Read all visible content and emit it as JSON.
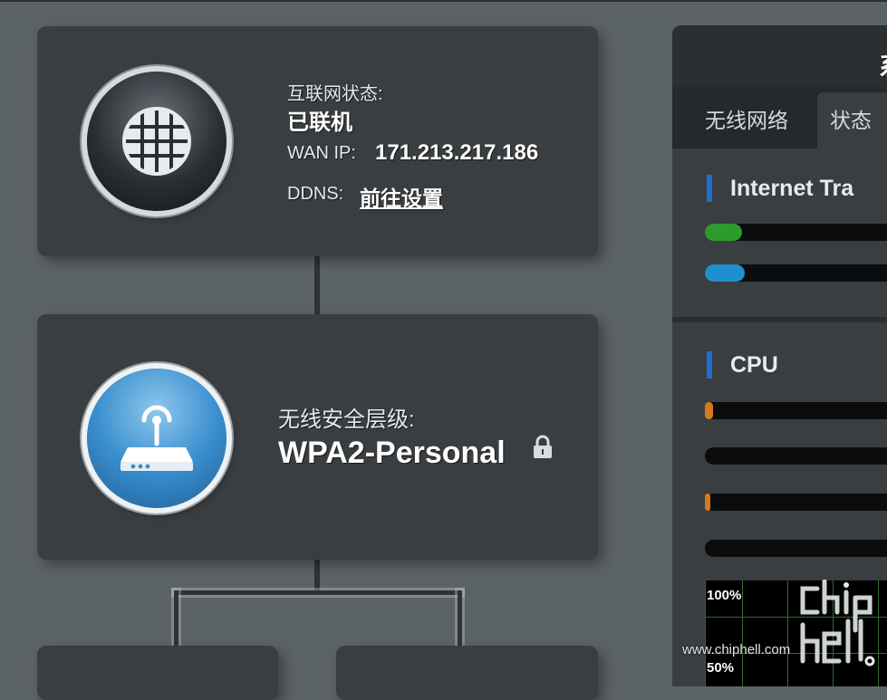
{
  "internet_card": {
    "status_label": "互联网状态:",
    "status_value": "已联机",
    "wan_ip_label": "WAN IP:",
    "wan_ip_value": "171.213.217.186",
    "ddns_label": "DDNS:",
    "ddns_link": "前往设置",
    "icon": "globe-icon"
  },
  "wireless_card": {
    "security_label": "无线安全层级:",
    "security_value": "WPA2-Personal",
    "icon": "router-icon",
    "lock_icon": "lock-icon"
  },
  "status_panel": {
    "title_partial": "系",
    "tabs": [
      {
        "label": "无线网络"
      },
      {
        "label": "状态"
      }
    ],
    "internet_traffic": {
      "title": "Internet Tra",
      "bars": [
        {
          "color": "#2e9b2e",
          "fill": 0.18
        },
        {
          "color": "#1f8fd0",
          "fill": 0.19
        }
      ]
    },
    "cpu": {
      "title": "CPU",
      "bars": [
        {
          "color": "#d6791b",
          "fill": 0.04
        },
        {
          "color": "#d6791b",
          "fill": 0.0
        },
        {
          "color": "#d6791b",
          "fill": 0.01
        },
        {
          "color": "#d6791b",
          "fill": 0.0
        }
      ],
      "graph_labels": [
        "100%",
        "50%"
      ]
    }
  },
  "watermark": {
    "site": "www.chiphell.com",
    "logo_text": "chip hell"
  },
  "colors": {
    "accent": "#1e6fd0",
    "background": "#5c6367",
    "card": "#3a3e40"
  }
}
